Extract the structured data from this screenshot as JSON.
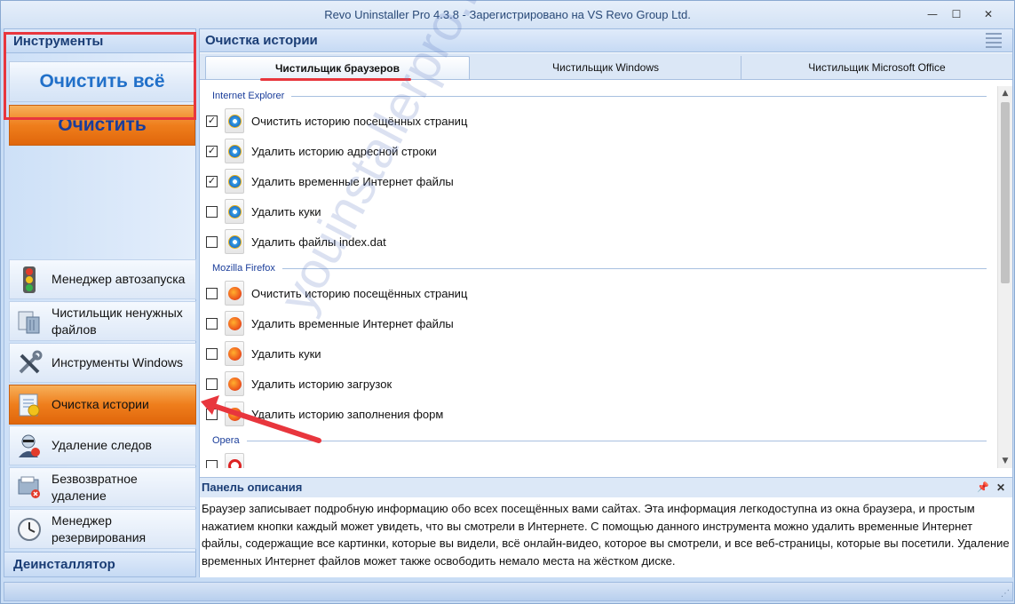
{
  "window": {
    "title": "Revo Uninstaller Pro 4.3.8 - Зарегистрировано на VS Revo Group Ltd.",
    "minimize": "—",
    "maximize": "☐",
    "close": "✕"
  },
  "sidebar": {
    "header": "Инструменты",
    "clean_all": "Очистить всё",
    "clean": "Очистить",
    "items": [
      {
        "label": "Менеджер автозапуска",
        "icon": "traffic-light-icon"
      },
      {
        "label": "Чистильщик ненужных файлов",
        "icon": "trash-files-icon"
      },
      {
        "label": "Инструменты Windows",
        "icon": "tools-icon"
      },
      {
        "label": "Очистка истории",
        "icon": "history-clean-icon"
      },
      {
        "label": "Удаление следов",
        "icon": "spy-icon"
      },
      {
        "label": "Безвозвратное удаление",
        "icon": "shred-icon"
      },
      {
        "label": "Менеджер резервирования",
        "icon": "backup-clock-icon"
      }
    ],
    "footer": "Деинсталлятор"
  },
  "main": {
    "title": "Очистка истории",
    "tabs": [
      "Чистильщик браузеров",
      "Чистильщик Windows",
      "Чистильщик Microsoft Office"
    ],
    "groups": [
      {
        "name": "Internet Explorer",
        "items": [
          {
            "label": "Очистить историю посещённых страниц",
            "checked": true
          },
          {
            "label": "Удалить историю адресной строки",
            "checked": true
          },
          {
            "label": "Удалить временные Интернет файлы",
            "checked": true
          },
          {
            "label": "Удалить куки",
            "checked": false
          },
          {
            "label": "Удалить файлы index.dat",
            "checked": false
          }
        ]
      },
      {
        "name": "Mozilla Firefox",
        "items": [
          {
            "label": "Очистить историю посещённых страниц",
            "checked": false
          },
          {
            "label": "Удалить временные Интернет файлы",
            "checked": false
          },
          {
            "label": "Удалить куки",
            "checked": false
          },
          {
            "label": "Удалить историю загрузок",
            "checked": false
          },
          {
            "label": "Удалить историю заполнения форм",
            "checked": false
          }
        ]
      },
      {
        "name": "Opera",
        "items": []
      }
    ]
  },
  "description": {
    "title": "Панель описания",
    "text": "Браузер записывает подробную информацию обо всех посещённых вами сайтах. Эта информация легкодоступна из окна браузера, и простым нажатием кнопки каждый может увидеть, что вы смотрели в Интернете. С помощью данного инструмента можно удалить временные Интернет файлы, содержащие все картинки, которые вы видели, всё онлайн-видео, которое вы смотрели, и все веб-страницы, которые вы посетили. Удаление временных Интернет файлов может также освободить немало места на жёстком диске.",
    "pin": "📌",
    "close": "✕"
  },
  "watermark": "youinstallerpro.ru",
  "colors": {
    "accent_orange": "#ef7e1c",
    "highlight_red": "#e8363d",
    "link_blue": "#2170c9"
  }
}
